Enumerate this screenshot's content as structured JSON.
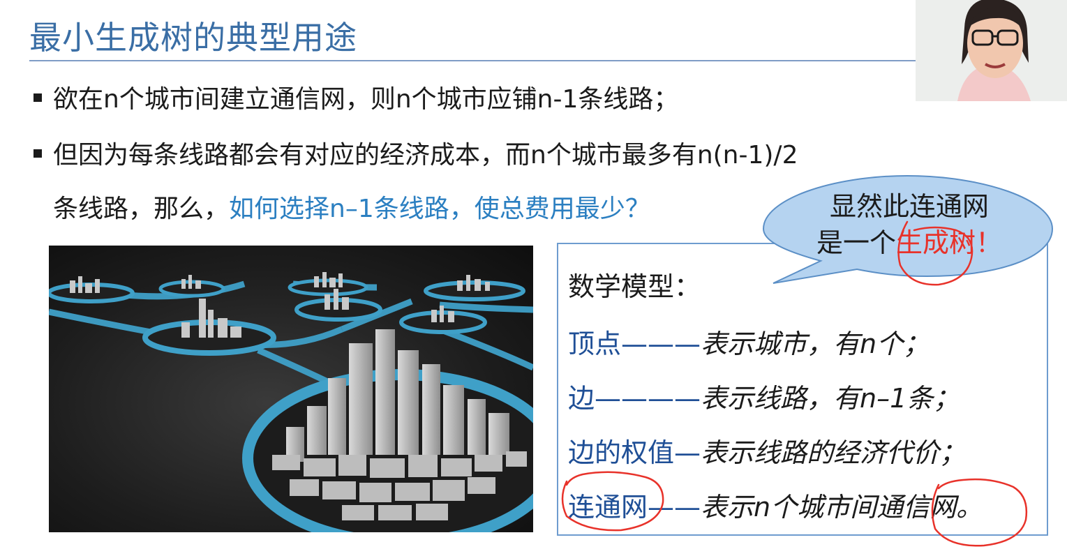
{
  "slide": {
    "title": "最小生成树的典型用途",
    "bullet1": "欲在n个城市间建立通信网，则n个城市应铺n-1条线路；",
    "bullet2_line1": "但因为每条线路都会有对应的经济成本，而n个城市最多有n(n-1)/2",
    "bullet2_line2_prefix": "条线路，那么，",
    "bullet2_highlight": "如何选择n–1条线路，使总费用最少？"
  },
  "bubble": {
    "line1": "显然此连通网",
    "line2_prefix": "是一个",
    "line2_red": "生成树",
    "line2_suffix": "！"
  },
  "model": {
    "title": "数学模型：",
    "rows": [
      {
        "term": "顶点",
        "dash": "———",
        "desc": "表示城市，有n个；"
      },
      {
        "term": "边",
        "dash": "————",
        "desc": "表示线路，有n–1条；"
      },
      {
        "term": "边的权值",
        "dash": "—",
        "desc": "表示线路的经济代价；"
      },
      {
        "term": "连通网",
        "dash": "——",
        "desc": "表示n个城市间通信网。"
      }
    ]
  },
  "colors": {
    "title": "#3a6ea5",
    "highlight": "#2b7fc1",
    "term": "#1f4f96",
    "red": "#e8322a",
    "bubble_fill": "#b5d3f0"
  }
}
